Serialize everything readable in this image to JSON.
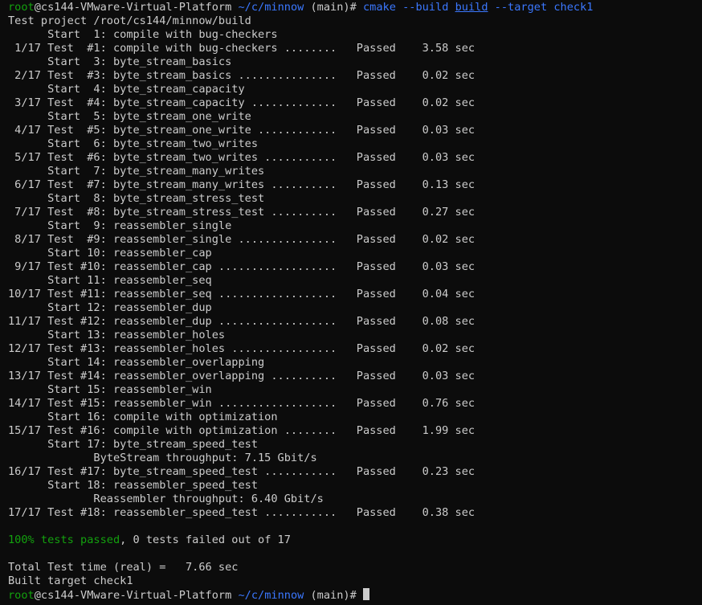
{
  "window": {
    "background": "#0c0c0c",
    "foreground": "#cccccc",
    "green": "#13a10e",
    "blue": "#3b78ff"
  },
  "prompt": {
    "user_host": "root",
    "at_host": "@cs144-VMware-Virtual-Platform",
    "path": "~/c/minnow",
    "branch": " (main)# "
  },
  "command": {
    "exe": "cmake",
    "flag1": " --build ",
    "dir": "build",
    "flag2": " --target check1"
  },
  "project_line": "Test project /root/cs144/minnow/build",
  "output_lines": [
    "      Start  1: compile with bug-checkers",
    " 1/17 Test  #1: compile with bug-checkers ........   Passed    3.58 sec",
    "      Start  3: byte_stream_basics",
    " 2/17 Test  #3: byte_stream_basics ...............   Passed    0.02 sec",
    "      Start  4: byte_stream_capacity",
    " 3/17 Test  #4: byte_stream_capacity .............   Passed    0.02 sec",
    "      Start  5: byte_stream_one_write",
    " 4/17 Test  #5: byte_stream_one_write ............   Passed    0.03 sec",
    "      Start  6: byte_stream_two_writes",
    " 5/17 Test  #6: byte_stream_two_writes ...........   Passed    0.03 sec",
    "      Start  7: byte_stream_many_writes",
    " 6/17 Test  #7: byte_stream_many_writes ..........   Passed    0.13 sec",
    "      Start  8: byte_stream_stress_test",
    " 7/17 Test  #8: byte_stream_stress_test ..........   Passed    0.27 sec",
    "      Start  9: reassembler_single",
    " 8/17 Test  #9: reassembler_single ...............   Passed    0.02 sec",
    "      Start 10: reassembler_cap",
    " 9/17 Test #10: reassembler_cap ..................   Passed    0.03 sec",
    "      Start 11: reassembler_seq",
    "10/17 Test #11: reassembler_seq ..................   Passed    0.04 sec",
    "      Start 12: reassembler_dup",
    "11/17 Test #12: reassembler_dup ..................   Passed    0.08 sec",
    "      Start 13: reassembler_holes",
    "12/17 Test #13: reassembler_holes ................   Passed    0.02 sec",
    "      Start 14: reassembler_overlapping",
    "13/17 Test #14: reassembler_overlapping ..........   Passed    0.03 sec",
    "      Start 15: reassembler_win",
    "14/17 Test #15: reassembler_win ..................   Passed    0.76 sec",
    "      Start 16: compile with optimization",
    "15/17 Test #16: compile with optimization ........   Passed    1.99 sec",
    "      Start 17: byte_stream_speed_test",
    "             ByteStream throughput: 7.15 Gbit/s",
    "16/17 Test #17: byte_stream_speed_test ...........   Passed    0.23 sec",
    "      Start 18: reassembler_speed_test",
    "             Reassembler throughput: 6.40 Gbit/s",
    "17/17 Test #18: reassembler_speed_test ...........   Passed    0.38 sec"
  ],
  "summary": {
    "passed_text": "100% tests passed",
    "rest_text": ", 0 tests failed out of 17"
  },
  "total_time_line": "Total Test time (real) =   7.66 sec",
  "built_line": "Built target check1"
}
